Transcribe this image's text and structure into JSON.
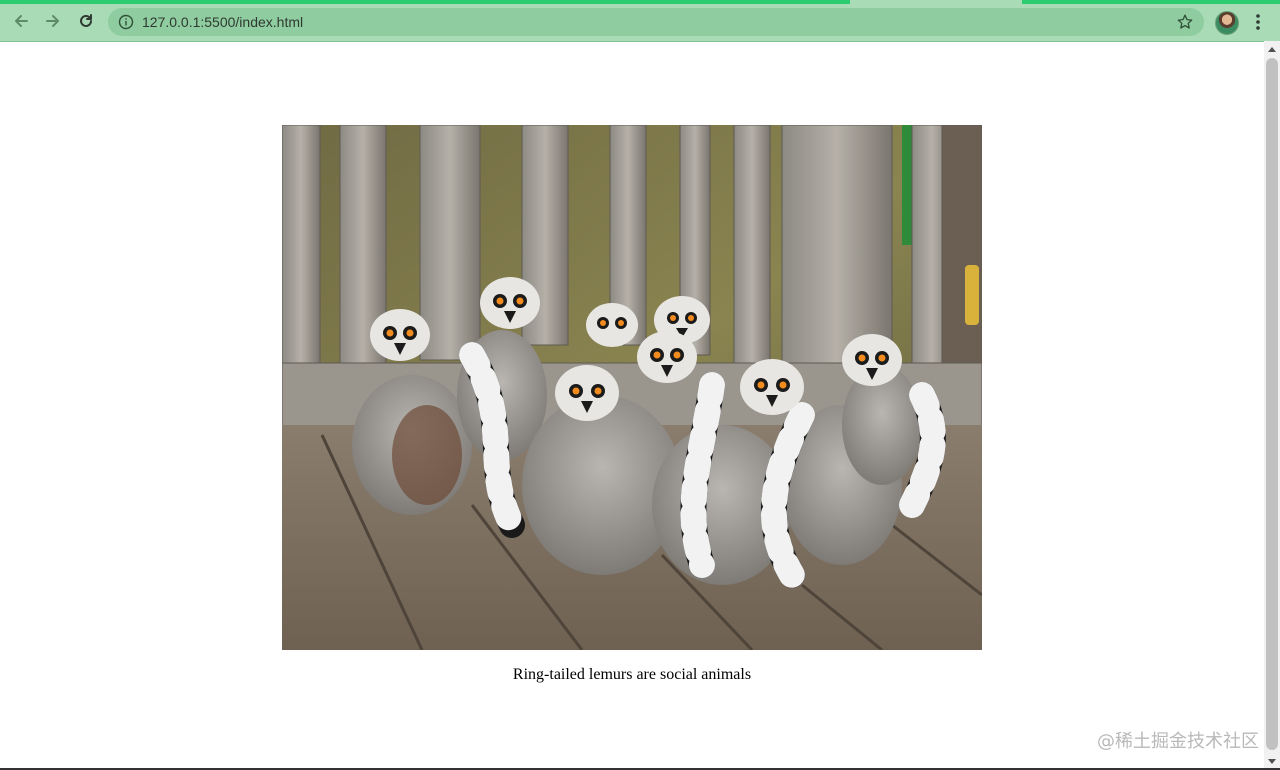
{
  "browser": {
    "url": "127.0.0.1:5500/index.html",
    "back_icon": "arrow-left-icon",
    "forward_icon": "arrow-right-icon",
    "reload_icon": "reload-icon",
    "info_icon": "info-icon",
    "bookmark_icon": "star-icon",
    "menu_icon": "more-vert-icon",
    "accent_color": "#2ecc71",
    "toolbar_color": "#a9dcb6"
  },
  "page": {
    "caption": "Ring-tailed lemurs are social animals"
  },
  "watermark": "@稀土掘金技术社区"
}
